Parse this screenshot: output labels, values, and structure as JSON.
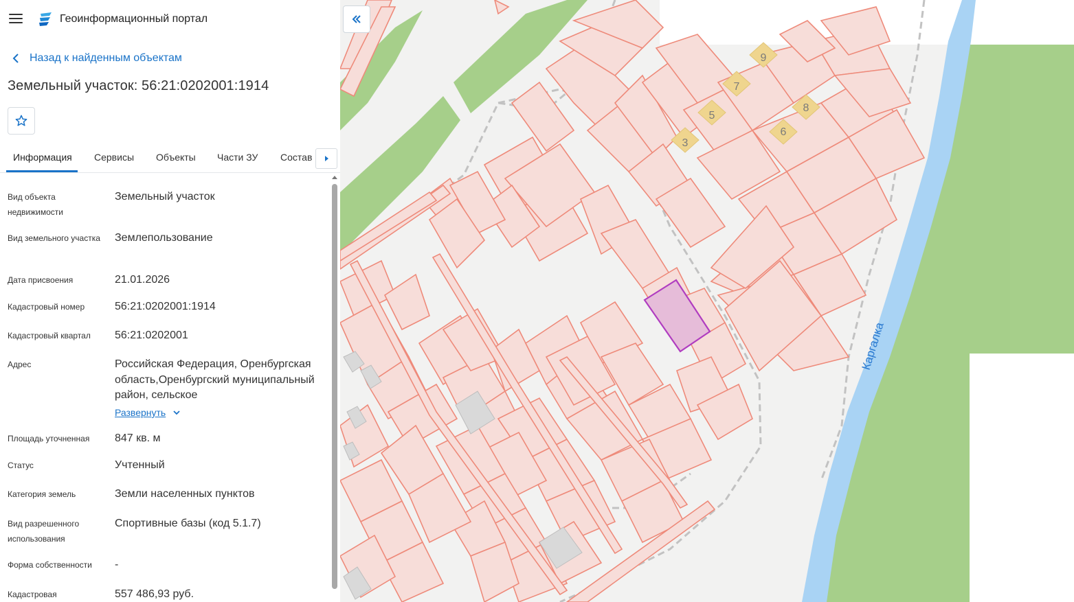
{
  "app": {
    "title": "Геоинформационный портал",
    "accent_color": "#1a73c8",
    "menu_icon": "hamburger-menu-icon",
    "logo_icon": "portal-logo-icon"
  },
  "nav": {
    "back_label": "Назад к найденным объектам",
    "back_icon": "chevron-left-icon"
  },
  "object": {
    "title": "Земельный участок: 56:21:0202001:1914",
    "favorite_icon": "star-outline-icon"
  },
  "tabs": [
    {
      "label": "Информация",
      "active": true
    },
    {
      "label": "Сервисы",
      "active": false
    },
    {
      "label": "Объекты",
      "active": false
    },
    {
      "label": "Части ЗУ",
      "active": false
    },
    {
      "label": "Состав",
      "active": false
    }
  ],
  "tabs_next_icon": "caret-right-icon",
  "info": [
    {
      "label": "Вид объекта недвижимости",
      "value": "Земельный участок"
    },
    {
      "label": "Вид земельного участка",
      "value": "Землепользование"
    },
    {
      "label": "Дата присвоения",
      "value": "21.01.2026"
    },
    {
      "label": "Кадастровый номер",
      "value": "56:21:0202001:1914"
    },
    {
      "label": "Кадастровый квартал",
      "value": "56:21:0202001"
    },
    {
      "label": "Адрес",
      "value": "Российская Федерация, Оренбургская область,Оренбургский муниципальный район, сельское"
    },
    {
      "label": "Площадь уточненная",
      "value": "847 кв. м"
    },
    {
      "label": "Статус",
      "value": "Учтенный"
    },
    {
      "label": "Категория земель",
      "value": "Земли населенных пунктов"
    },
    {
      "label": "Вид разрешенного использования",
      "value": "Спортивные базы (код 5.1.7)"
    },
    {
      "label": "Форма собственности",
      "value": "-"
    },
    {
      "label": "Кадастровая",
      "value": "557 486,93 руб."
    }
  ],
  "expand_label": "Развернуть",
  "expand_icon": "chevron-down-icon",
  "map": {
    "collapse_icon": "double-chevron-left-icon",
    "river_label": "Каргалка",
    "building_numbers": [
      "9",
      "7",
      "5",
      "8",
      "3",
      "6"
    ],
    "colors": {
      "parcel_fill": "#f7ddd9",
      "parcel_stroke": "#ee8a7a",
      "selected_fill": "#e6bcd9",
      "selected_stroke": "#b03cc0",
      "green": "#a6cf8a",
      "water": "#a9d3f4",
      "building": "#efd58e",
      "road_dash": "#c2c2c2"
    }
  }
}
